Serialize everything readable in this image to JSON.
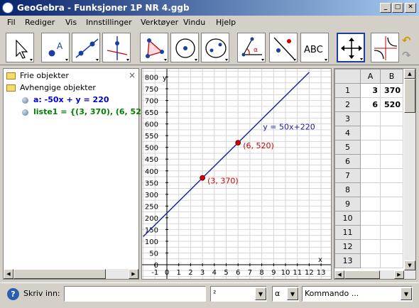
{
  "window": {
    "title": "GeoGebra - Funksjoner 1P NR 4.ggb"
  },
  "menu": [
    "Fil",
    "Rediger",
    "Vis",
    "Innstillinger",
    "Verktøyer",
    "Vindu",
    "Hjelp"
  ],
  "toolbar": {
    "text_tool_label": "ABC"
  },
  "algebra": {
    "free_folder": "Frie objekter",
    "dependent_folder": "Avhengige objekter",
    "items": [
      {
        "text": "a: -50x + y = 220",
        "color": "#0000cc"
      },
      {
        "text": "liste1 = {(3, 370), (6, 520)}",
        "color": "#008000"
      }
    ]
  },
  "graphics": {
    "y_axis_label": "y",
    "x_axis_label": "x",
    "x_ticks": [
      "-1",
      "0",
      "1",
      "2",
      "3",
      "4",
      "5",
      "6",
      "7",
      "8",
      "9",
      "10",
      "11",
      "12",
      "13"
    ],
    "y_ticks": [
      "800",
      "750",
      "700",
      "650",
      "600",
      "550",
      "500",
      "450",
      "400",
      "350",
      "300",
      "250",
      "200",
      "150",
      "100",
      "50",
      "0"
    ],
    "line_label": "y = 50x+220",
    "line_color": "#1a1aa6",
    "point_color": "#cc0000",
    "points": [
      {
        "x": 3,
        "y": 370,
        "label": "(3, 370)"
      },
      {
        "x": 6,
        "y": 520,
        "label": "(6, 520)"
      }
    ]
  },
  "spreadsheet": {
    "columns": [
      "A",
      "B"
    ],
    "rows": [
      {
        "n": "1",
        "A": "3",
        "B": "370"
      },
      {
        "n": "2",
        "A": "6",
        "B": "520"
      },
      {
        "n": "3",
        "A": "",
        "B": ""
      },
      {
        "n": "4",
        "A": "",
        "B": ""
      },
      {
        "n": "5",
        "A": "",
        "B": ""
      },
      {
        "n": "6",
        "A": "",
        "B": ""
      },
      {
        "n": "7",
        "A": "",
        "B": ""
      },
      {
        "n": "8",
        "A": "",
        "B": ""
      },
      {
        "n": "9",
        "A": "",
        "B": ""
      },
      {
        "n": "10",
        "A": "",
        "B": ""
      },
      {
        "n": "11",
        "A": "",
        "B": ""
      },
      {
        "n": "12",
        "A": "",
        "B": ""
      },
      {
        "n": "13",
        "A": "",
        "B": ""
      }
    ]
  },
  "inputbar": {
    "label": "Skriv inn:",
    "input_value": "",
    "symbol_select": "²",
    "greek_select": "α",
    "command_select": "Kommando ..."
  }
}
